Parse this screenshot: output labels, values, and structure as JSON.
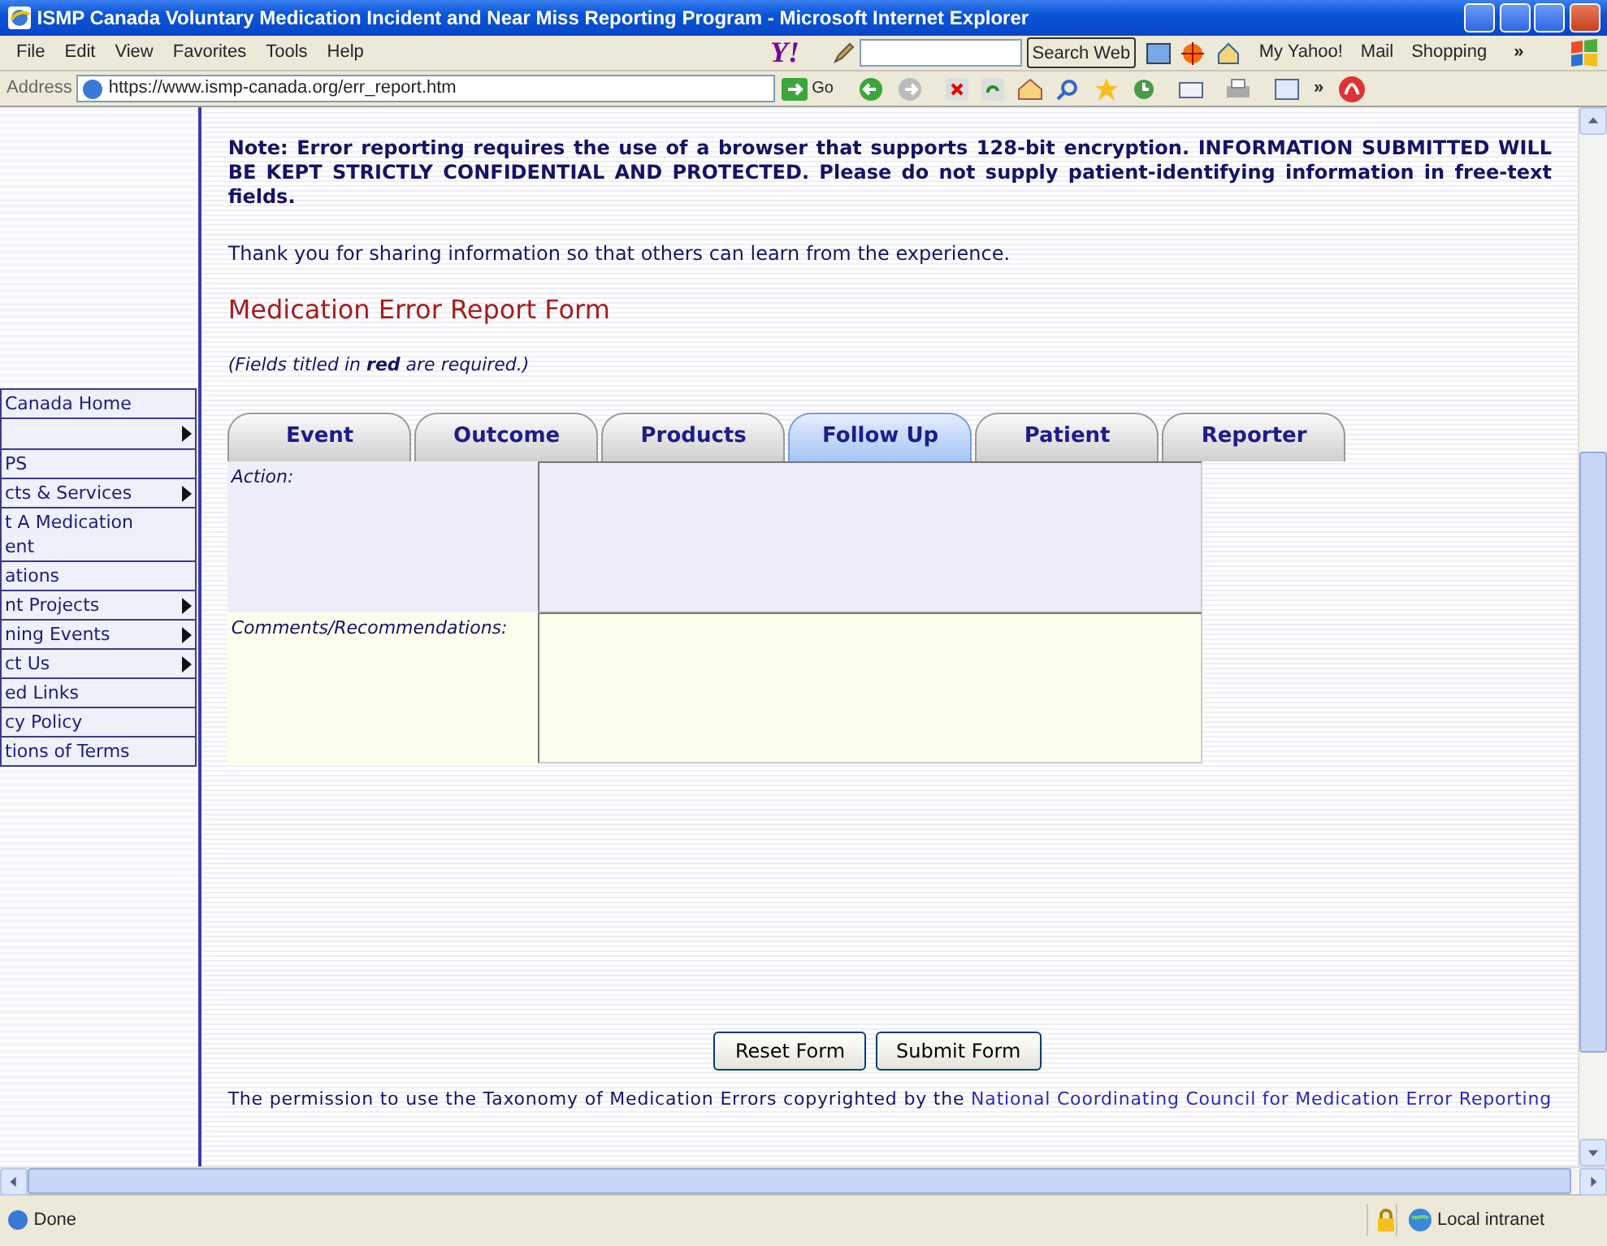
{
  "window": {
    "title": "ISMP Canada Voluntary Medication Incident and Near Miss Reporting Program - Microsoft Internet Explorer"
  },
  "menu_bar": [
    "File",
    "Edit",
    "View",
    "Favorites",
    "Tools",
    "Help"
  ],
  "yahoo_toolbar": {
    "logo": "Y!",
    "search_button": "Search Web",
    "links": [
      "My Yahoo!",
      "Mail",
      "Shopping"
    ],
    "more": "»"
  },
  "address_bar": {
    "label": "Address",
    "url": "https://www.ismp-canada.org/err_report.htm",
    "go": "Go",
    "more": "»"
  },
  "sidebar": {
    "items": [
      {
        "label": "Canada Home",
        "submenu": false
      },
      {
        "submenu": true
      },
      {
        "label": "PS",
        "submenu": false
      },
      {
        "label": "cts & Services",
        "submenu": true
      },
      {
        "label": "t A Medication ent",
        "submenu": false
      },
      {
        "label": "ations",
        "submenu": false
      },
      {
        "label": "nt Projects",
        "submenu": true
      },
      {
        "label": "ning Events",
        "submenu": true
      },
      {
        "label": "ct Us",
        "submenu": true
      },
      {
        "label": "ed Links",
        "submenu": false
      },
      {
        "label": "cy Policy",
        "submenu": false
      },
      {
        "label": "tions of Terms",
        "submenu": false
      }
    ]
  },
  "content": {
    "note": "Note: Error reporting requires the use of a browser that supports 128-bit encryption. INFORMATION SUBMITTED WILL BE KEPT STRICTLY CONFIDENTIAL AND PROTECTED. Please do not supply patient-identifying information in free-text fields.",
    "thanks": "Thank you for sharing information so that others can learn from the experience.",
    "heading": "Medication Error Report Form",
    "required_note": "(Fields titled in **red** are required.)",
    "tabs": [
      {
        "label": "Event",
        "selected": false
      },
      {
        "label": "Outcome",
        "selected": false
      },
      {
        "label": "Products",
        "selected": false
      },
      {
        "label": "Follow Up",
        "selected": true
      },
      {
        "label": "Patient",
        "selected": false
      },
      {
        "label": "Reporter",
        "selected": false
      }
    ],
    "fields": [
      {
        "label": "Action:",
        "color": "#eeeefa"
      },
      {
        "label": "Comments/Recommendations:",
        "color": "#fdfded"
      }
    ],
    "buttons": [
      "Reset Form",
      "Submit Form"
    ],
    "footer": {
      "text": "The permission to use the Taxonomy of Medication Errors copyrighted by the",
      "link": "National Coordinating Council for Medication Error Reporting"
    }
  },
  "status_bar": {
    "text": "Done",
    "zone": "Local intranet"
  }
}
